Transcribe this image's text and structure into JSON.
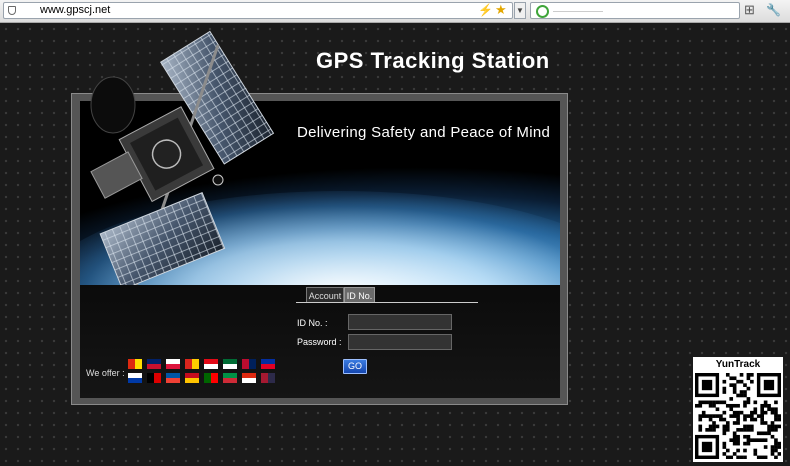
{
  "browser": {
    "url": "www.gpscj.net"
  },
  "site": {
    "title": "GPS Tracking Station",
    "tagline": "Delivering Safety and Peace of Mind"
  },
  "login": {
    "tabs": [
      "Account",
      "ID No."
    ],
    "id_label": "ID No. :",
    "password_label": "Password :",
    "id_value": "",
    "password_value": "",
    "go_label": "GO"
  },
  "languages": {
    "label": "We offer :",
    "flags": [
      {
        "name": "china",
        "colors": [
          "#de2910",
          "#ffde00"
        ]
      },
      {
        "name": "united-kingdom",
        "colors": [
          "#012169",
          "#c8102e"
        ]
      },
      {
        "name": "poland",
        "colors": [
          "#ffffff",
          "#dc143c"
        ]
      },
      {
        "name": "vietnam",
        "colors": [
          "#da251d",
          "#ffcd00"
        ]
      },
      {
        "name": "turkey",
        "colors": [
          "#e30a17",
          "#ffffff"
        ]
      },
      {
        "name": "saudi-arabia",
        "colors": [
          "#006c35",
          "#ffffff"
        ]
      },
      {
        "name": "norway",
        "colors": [
          "#ba0c2f",
          "#00205b"
        ]
      },
      {
        "name": "cambodia",
        "colors": [
          "#032ea1",
          "#e00025"
        ]
      },
      {
        "name": "russia",
        "colors": [
          "#ffffff",
          "#0039a6"
        ]
      },
      {
        "name": "germany",
        "colors": [
          "#000000",
          "#dd0000"
        ]
      },
      {
        "name": "france",
        "colors": [
          "#0055a4",
          "#ef4135"
        ]
      },
      {
        "name": "spain",
        "colors": [
          "#c60b1e",
          "#ffc400"
        ]
      },
      {
        "name": "portugal",
        "colors": [
          "#006600",
          "#ff0000"
        ]
      },
      {
        "name": "italy",
        "colors": [
          "#009246",
          "#ce2b37"
        ]
      },
      {
        "name": "hong-kong",
        "colors": [
          "#de2910",
          "#ffffff"
        ]
      },
      {
        "name": "thailand",
        "colors": [
          "#a51931",
          "#2d2a4a"
        ]
      }
    ]
  },
  "qr": {
    "title": "YunTrack"
  }
}
